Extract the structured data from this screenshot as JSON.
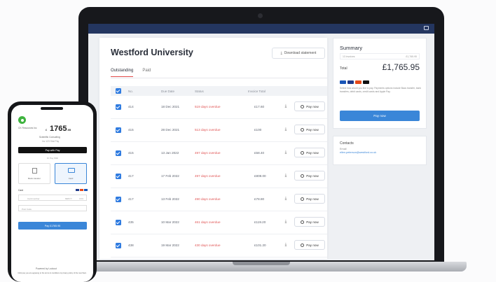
{
  "statement": {
    "title": "Westford University",
    "download_label": "Download statement",
    "tabs": [
      "Outstanding",
      "Paid"
    ],
    "columns": [
      "No.",
      "Due Date",
      "Status",
      "Invoice Total"
    ],
    "pay_label": "Pay now",
    "rows": [
      {
        "no": "414",
        "due": "18 Dec 2021",
        "status": "519 days overdue",
        "total": "£17.60"
      },
      {
        "no": "415",
        "due": "28 Dec 2021",
        "status": "513 days overdue",
        "total": "£100"
      },
      {
        "no": "415",
        "due": "13 Jan 2022",
        "status": "497 days overdue",
        "total": "£58.40"
      },
      {
        "no": "417",
        "due": "17 Feb 2022",
        "status": "497 days overdue",
        "total": "£808.00"
      },
      {
        "no": "417",
        "due": "13 Feb 2022",
        "status": "490 days overdue",
        "total": "£78.80"
      },
      {
        "no": "435",
        "due": "10 Mar 2022",
        "status": "461 days overdue",
        "total": "£119.20"
      },
      {
        "no": "438",
        "due": "19 Mar 2022",
        "status": "430 days overdue",
        "total": "£101.20"
      }
    ]
  },
  "summary": {
    "title": "Summary",
    "line_label": "13 invoices",
    "line_value": "£1,765.95",
    "total_label": "Total",
    "total_value": "£1,765.95",
    "pay_label": "Pay now",
    "help_text": "Select how would you like to pay. Payments options include Bacs transfer, bank transfers, debit cards, credit cards and Apple Pay."
  },
  "contacts": {
    "title": "Contacts",
    "email_label": "Email",
    "email": "ellen.peterson@westford.co.uk"
  },
  "phone": {
    "company": "CK Resources Inc",
    "amount": "1765",
    "amount_decimals": ".95",
    "currency": "£",
    "merchant": "Scientific Consulting",
    "invoice_ref": "Inv 123 Stat Pay",
    "apple_pay": "Pay with  Pay",
    "or_label": "Or Pay With",
    "option_bank": "Bank transfer",
    "option_card": "Card",
    "card_label": "Card",
    "card_number_placeholder": "Card number",
    "expiry_placeholder": "MM/YY",
    "cvc_placeholder": "CVC",
    "postcode_placeholder": "Post Code",
    "pay_button": "Pay £1765.95",
    "footer_brand": "Powered by  Lockout",
    "footer_text": "Click pay you are agreeing to the terms & conditions & privacy policy of the merchant."
  },
  "colors": {
    "accent": "#3a86d8",
    "overdue": "#e05454",
    "navbar": "#243660"
  }
}
